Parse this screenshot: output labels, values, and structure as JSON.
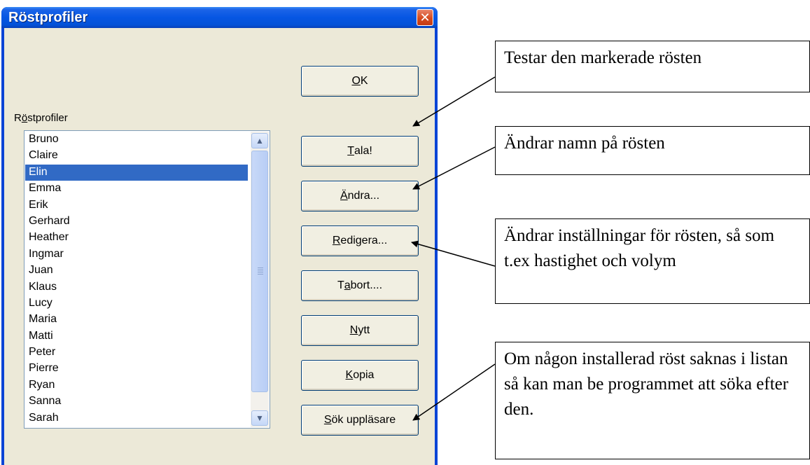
{
  "window": {
    "title": "Röstprofiler"
  },
  "list_label": {
    "before": "R",
    "accel": "ö",
    "after": "stprofiler"
  },
  "voices": [
    "Bruno",
    "Claire",
    "Elin",
    "Emma",
    "Erik",
    "Gerhard",
    "Heather",
    "Ingmar",
    "Juan",
    "Klaus",
    "Lucy",
    "Maria",
    "Matti",
    "Peter",
    "Pierre",
    "Ryan",
    "Sanna",
    "Sarah"
  ],
  "selected_voice": "Elin",
  "buttons": {
    "ok": {
      "accel": "O",
      "rest": "K"
    },
    "tala": {
      "accel": "T",
      "rest": "ala!"
    },
    "andra": {
      "accel": "Ä",
      "rest": "ndra..."
    },
    "redigera": {
      "accel": "R",
      "rest": "edigera..."
    },
    "tabort": {
      "pre": "T",
      "accel": "a",
      "rest": " bort...."
    },
    "nytt": {
      "accel": "N",
      "rest": "ytt"
    },
    "kopia": {
      "accel": "K",
      "rest": "opia"
    },
    "sok": {
      "accel": "S",
      "rest": "ök uppläsare"
    }
  },
  "callouts": {
    "testar": "Testar den markerade rösten",
    "andrar_namn": "Ändrar namn på rösten",
    "installningar": "Ändrar inställningar för rösten, så som t.ex hastighet och volym",
    "sok": "Om någon installerad röst saknas i listan så kan man be programmet att söka efter den."
  },
  "icons": {
    "close": "close-icon",
    "scroll_up": "chevron-up-icon",
    "scroll_down": "chevron-down-icon"
  }
}
